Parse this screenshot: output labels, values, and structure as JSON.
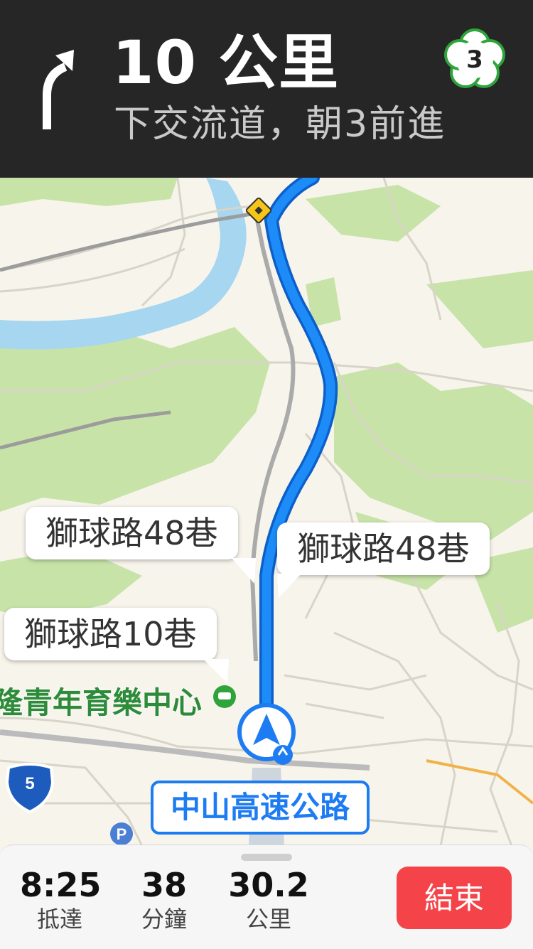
{
  "header": {
    "distance": "10 公里",
    "instruction": "下交流道，朝3前進",
    "exit_number": "3",
    "turn_icon": "turn-slight-left-arrow"
  },
  "map": {
    "callouts": [
      {
        "label": "獅球路48巷"
      },
      {
        "label": "獅球路48巷"
      },
      {
        "label": "獅球路10巷"
      }
    ],
    "poi_label": "隆青年育樂中心",
    "road_label": "中山高速公路",
    "highway_shield": "5",
    "parking_icon": "P",
    "colors": {
      "route": "#1d7cf2",
      "park": "#c7e3a8",
      "water": "#a6d6f0",
      "land": "#f7f4ec"
    }
  },
  "trip": {
    "arrival_time": "8:25",
    "arrival_label": "抵達",
    "minutes": "38",
    "minutes_label": "分鐘",
    "distance": "30.2",
    "distance_label": "公里",
    "end_button": "結束"
  }
}
